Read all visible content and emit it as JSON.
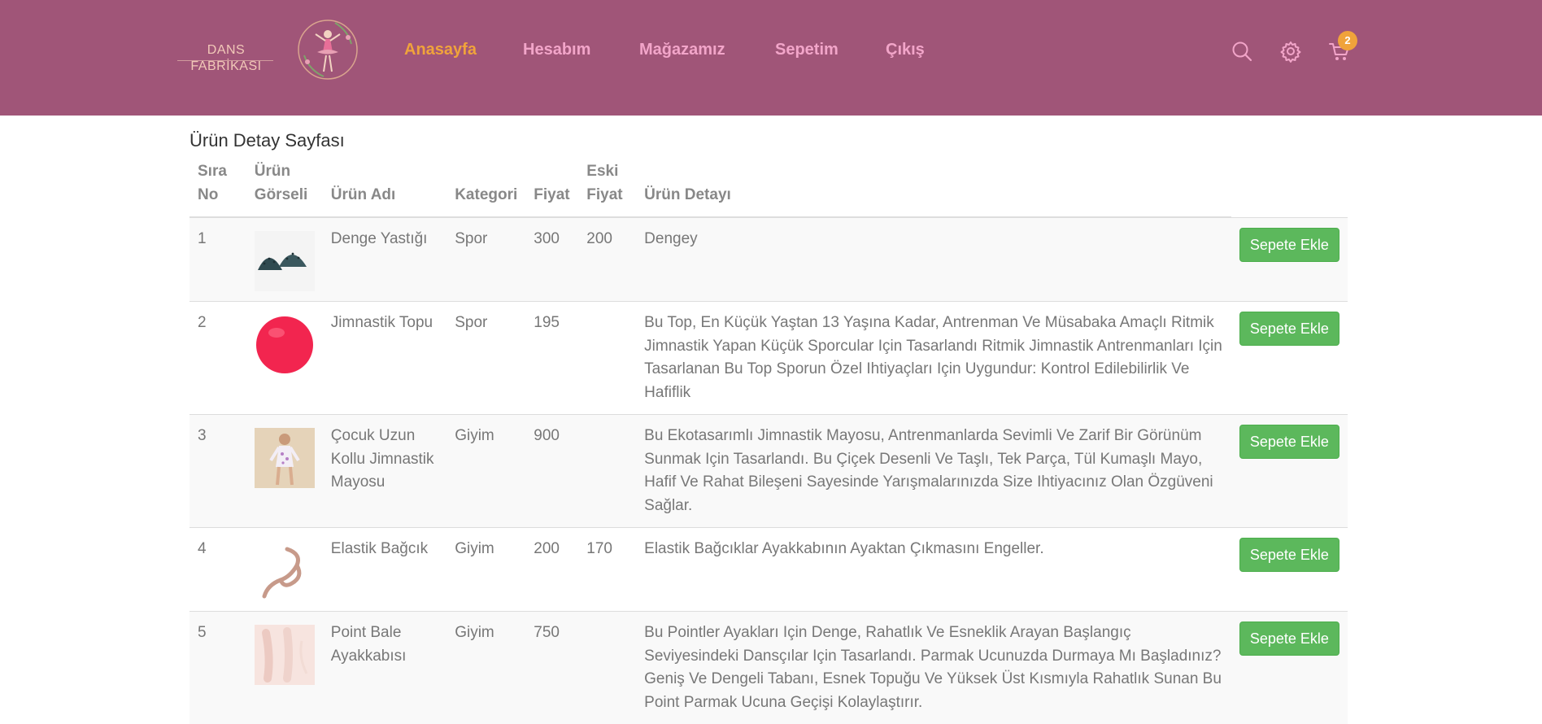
{
  "brand": {
    "line1": "DANS",
    "line2": "FABRİKASI"
  },
  "nav": {
    "items": [
      {
        "label": "Anasayfa",
        "active": true
      },
      {
        "label": "Hesabım",
        "active": false
      },
      {
        "label": "Mağazamız",
        "active": false
      },
      {
        "label": "Sepetim",
        "active": false
      },
      {
        "label": "Çıkış",
        "active": false
      }
    ]
  },
  "header_icons": {
    "search": "search-icon",
    "settings": "gear-icon",
    "cart": "cart-icon",
    "cart_count": "2"
  },
  "colors": {
    "header_bg": "#a05578",
    "nav_link": "#f2a5c9",
    "nav_active": "#f0a33b",
    "button": "#5cb85c"
  },
  "page": {
    "title": "Ürün Detay Sayfası"
  },
  "table": {
    "headers": {
      "no_line1": "Sıra",
      "no_line2": "No",
      "img_line1": "Ürün",
      "img_line2": "Görseli",
      "name": "Ürün Adı",
      "category": "Kategori",
      "price": "Fiyat",
      "old_line1": "Eski",
      "old_line2": "Fiyat",
      "detail": "Ürün Detayı"
    },
    "rows": [
      {
        "no": "1",
        "image": "balance-cushion-image",
        "name": "Denge Yastığı",
        "category": "Spor",
        "price": "300",
        "old_price": "200",
        "detail": "Dengey",
        "button": "Sepete Ekle"
      },
      {
        "no": "2",
        "image": "gym-ball-image",
        "name": "Jimnastik Topu",
        "category": "Spor",
        "price": "195",
        "old_price": "",
        "detail": "Bu Top, En Küçük Yaştan 13 Yaşına Kadar, Antrenman Ve Müsabaka Amaçlı Ritmik Jimnastik Yapan Küçük Sporcular Için Tasarlandı Ritmik Jimnastik Antrenmanları Için Tasarlanan Bu Top Sporun Özel Ihtiyaçları Için Uygundur: Kontrol Edilebilirlik Ve Hafiflik",
        "button": "Sepete Ekle"
      },
      {
        "no": "3",
        "image": "leotard-image",
        "name": "Çocuk Uzun Kollu Jimnastik Mayosu",
        "category": "Giyim",
        "price": "900",
        "old_price": "",
        "detail": "Bu Ekotasarımlı Jimnastik Mayosu, Antrenmanlarda Sevimli Ve Zarif Bir Görünüm Sunmak Için Tasarlandı. Bu Çiçek Desenli Ve Taşlı, Tek Parça, Tül Kumaşlı Mayo, Hafif Ve Rahat Bileşeni Sayesinde Yarışmalarınızda Size Ihtiyacınız Olan Özgüveni Sağlar.",
        "button": "Sepete Ekle"
      },
      {
        "no": "4",
        "image": "elastic-band-image",
        "name": "Elastik Bağcık",
        "category": "Giyim",
        "price": "200",
        "old_price": "170",
        "detail": "Elastik Bağcıklar Ayakkabının Ayaktan Çıkmasını Engeller.",
        "button": "Sepete Ekle"
      },
      {
        "no": "5",
        "image": "pointe-shoes-image",
        "name": "Point Bale Ayakkabısı",
        "category": "Giyim",
        "price": "750",
        "old_price": "",
        "detail": "Bu Pointler Ayakları Için Denge, Rahatlık Ve Esneklik Arayan Başlangıç Seviyesindeki Dansçılar Için Tasarlandı. Parmak Ucunuzda Durmaya Mı Başladınız? Geniş Ve Dengeli Tabanı, Esnek Topuğu Ve Yüksek Üst Kısmıyla Rahatlık Sunan Bu Point Parmak Ucuna Geçişi Kolaylaştırır.",
        "button": "Sepete Ekle"
      }
    ]
  }
}
